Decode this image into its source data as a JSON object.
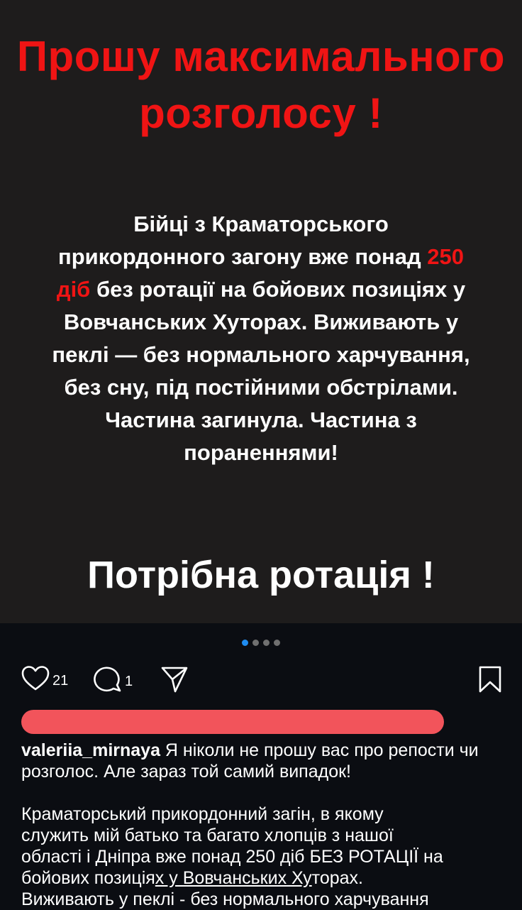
{
  "post_image": {
    "headline_line1": "Прошу максимального",
    "headline_line2": "розголосу !",
    "body": {
      "l1": "Бійці з Краматорського",
      "l2_a": "прикордонного загону вже понад ",
      "l2_b": "250",
      "l3_a": "діб",
      "l3_b": " без ротації на бойових позиціях у",
      "l4": "Вовчанських Хуторах. Виживають у",
      "l5": "пеклі — без нормального харчування,",
      "l6": "без сну, під постійними обстрілами.",
      "l7": "Частина загинула. Частина  з",
      "l8": "пораненнями!"
    },
    "cta": "Потрібна ротація !",
    "highlight_color": "#f01414"
  },
  "carousel": {
    "total": 4,
    "active": 1
  },
  "actions": {
    "likes": "21",
    "comments": "1",
    "icons": [
      "heart-icon",
      "comment-icon",
      "share-icon",
      "bookmark-icon"
    ]
  },
  "caption": {
    "username": "valeriia_mirnaya",
    "p1_rest": " Я ніколи не прошу вас про репости чи розголос. Але зараз той самий випадок!",
    "p2_l1": "Краматорський прикордонний загін, в якому",
    "p2_l2": "служить мій батько та багато хлопців з нашої",
    "p2_l3": "області і Дніпра вже понад 250 діб БЕЗ РОТАЦІЇ на",
    "p2_l4_a": "бойових позиція",
    "p2_l4_b": "х у Вовчанських Ху",
    "p2_l4_c": "торах.",
    "p2_l5": "Виживають у пеклі - без нормального харчування"
  }
}
